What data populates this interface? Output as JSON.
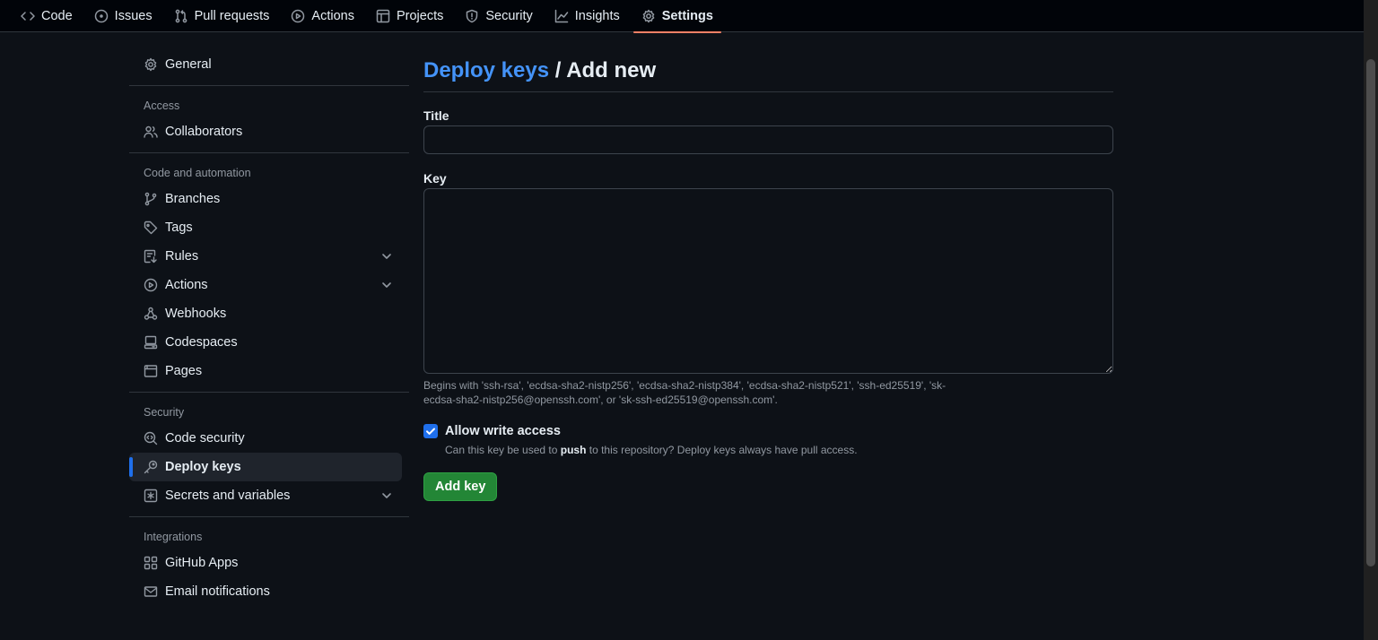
{
  "topnav": {
    "tabs": [
      {
        "label": "Code",
        "icon": "code-icon"
      },
      {
        "label": "Issues",
        "icon": "issue-icon"
      },
      {
        "label": "Pull requests",
        "icon": "pull-request-icon"
      },
      {
        "label": "Actions",
        "icon": "play-icon"
      },
      {
        "label": "Projects",
        "icon": "table-icon"
      },
      {
        "label": "Security",
        "icon": "shield-icon"
      },
      {
        "label": "Insights",
        "icon": "graph-icon"
      },
      {
        "label": "Settings",
        "icon": "gear-icon",
        "active": true
      }
    ]
  },
  "sidebar": {
    "general": "General",
    "access_heading": "Access",
    "collaborators": "Collaborators",
    "code_heading": "Code and automation",
    "branches": "Branches",
    "tags": "Tags",
    "rules": "Rules",
    "actions": "Actions",
    "webhooks": "Webhooks",
    "codespaces": "Codespaces",
    "pages": "Pages",
    "security_heading": "Security",
    "code_security": "Code security",
    "deploy_keys": "Deploy keys",
    "secrets": "Secrets and variables",
    "integrations_heading": "Integrations",
    "github_apps": "GitHub Apps",
    "email_notifications": "Email notifications"
  },
  "main": {
    "crumb": "Deploy keys",
    "title_rest": " / Add new",
    "title_label": "Title",
    "title_value": "",
    "key_label": "Key",
    "key_value": "",
    "key_hint": "Begins with 'ssh-rsa', 'ecdsa-sha2-nistp256', 'ecdsa-sha2-nistp384', 'ecdsa-sha2-nistp521', 'ssh-ed25519', 'sk-ecdsa-sha2-nistp256@openssh.com', or 'sk-ssh-ed25519@openssh.com'.",
    "write_access_label": "Allow write access",
    "write_access_checked": true,
    "write_desc_before": "Can this key be used to ",
    "write_desc_bold": "push",
    "write_desc_after": " to this repository? Deploy keys always have pull access.",
    "add_button": "Add key"
  },
  "colors": {
    "background": "#0d1117",
    "accent_link": "#4493f8",
    "active_tab_underline": "#f78166",
    "primary_button": "#238636",
    "checkbox": "#1f6feb"
  }
}
